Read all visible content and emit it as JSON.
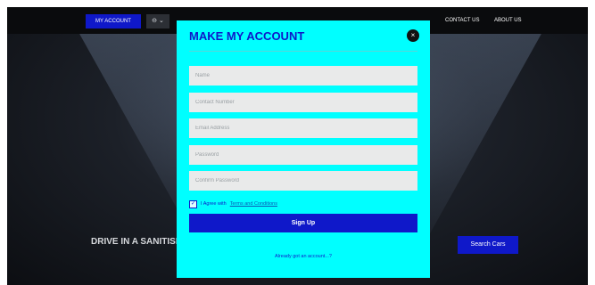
{
  "navbar": {
    "account_label": "MY ACCOUNT",
    "user_dropdown_label": "⊖ ⌄",
    "links": [
      {
        "label": "CONTACT US"
      },
      {
        "label": "ABOUT US"
      }
    ]
  },
  "hero": {
    "headline": "DRIVE IN A SANITISED",
    "search_label": "Search Cars"
  },
  "modal": {
    "title": "MAKE MY ACCOUNT",
    "close_label": "×",
    "fields": {
      "name_placeholder": "Name",
      "contact_placeholder": "Contact Number",
      "email_placeholder": "Email Address",
      "password_placeholder": "Password",
      "confirm_placeholder": "Confirm Password"
    },
    "agree_prefix": "I Agree with",
    "terms_label": "Terms and Conditions",
    "checkbox_mark": "✓",
    "signup_label": "Sign Up",
    "login_link": "Already got an account...?"
  },
  "colors": {
    "modal_bg": "#00ffff",
    "brand_blue": "#0f18c9",
    "field_bg": "#e9eaea"
  }
}
